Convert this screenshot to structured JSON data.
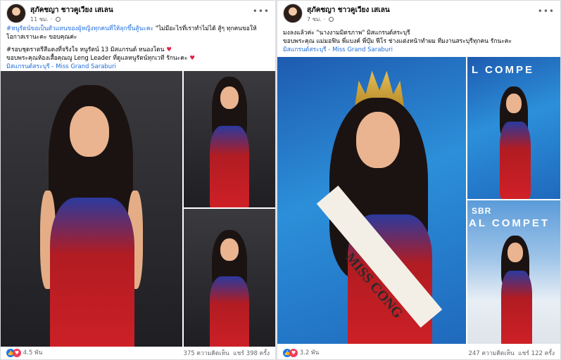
{
  "posts": [
    {
      "author": "สุภัคชญา ชาวคูเวียง เสเลน",
      "time": "11 ชม.",
      "caption_lines": [
        "#หนูรัตน์ขอเป็นตัวแทนของผู้หญิงทุกคนที่ให้ลุกขึ้นสู้นะคะ",
        "\"ไม่มีอะไรที่เราทำไม่ได้ สู้ๆ ทุกคนขอให้โอกาสเรานะคะ ขอบคุณค่ะ",
        "#รอบชุดราตรีสีแดงที่จริงใจ หนูรัตน์ 13 มิสแกรนด์ หนองโดน",
        "ขอบพระคุณห้องเสื้อคุณญู Leng Leader ที่ดูแลหนูรัตน์ทุกเวที รักนะคะ",
        "มิสแกรนด์สระบุรี - Miss Grand Saraburi"
      ],
      "reactions": "4.5 พัน",
      "comments": "375 ความคิดเห็น",
      "shares": "แชร์ 398 ครั้ง"
    },
    {
      "author": "สุภัคชญา ชาวคูเวียง เสเลน",
      "time": "7 ชม.",
      "caption_lines": [
        "มงลงแล้วค่ะ \"นางงามมิตรภาพ\" มิสแกรนด์สระบุรี",
        "ขอบพระคุณ แม่มอฟิน พี่แบงค์ พี่บุ๊ม ฟีโร ช่างแต่งหน้าทำผม ทีมงานสระบุรีทุกคน รักนะคะ",
        "มิสแกรนด์สระบุรี - Miss Grand Saraburi"
      ],
      "stage_text_1": "L COMPE",
      "stage_text_2": "AL COMPET",
      "stage_logo": "SBR",
      "sash_text": "MISS CONG",
      "reactions": "3.2 พัน",
      "comments": "247 ความคิดเห็น",
      "shares": "แชร์ 122 ครั้ง"
    }
  ],
  "icons": {
    "like": "like-icon",
    "love": "love-icon",
    "more": "more-options-icon",
    "privacy": "globe-icon"
  },
  "colors": {
    "link": "#216fdb",
    "like": "#1877f2",
    "love": "#f33e58",
    "dress_red": "#d02027"
  }
}
